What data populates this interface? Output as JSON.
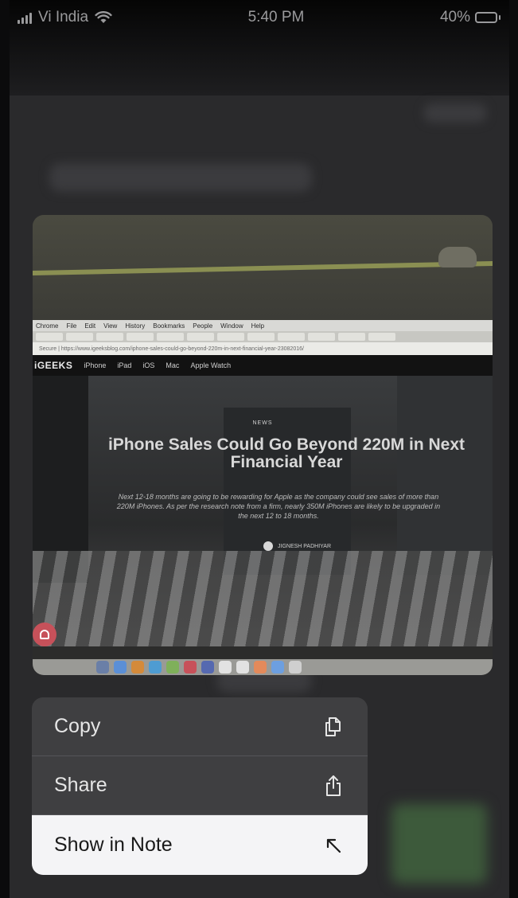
{
  "status_bar": {
    "carrier": "Vi India",
    "time": "5:40 PM",
    "battery_percent": "40%",
    "battery_level": 0.4,
    "icons": [
      "signal-icon",
      "wifi-icon",
      "battery-icon"
    ]
  },
  "preview": {
    "browser_menu": [
      "Chrome",
      "File",
      "Edit",
      "View",
      "History",
      "Bookmarks",
      "People",
      "Window",
      "Help"
    ],
    "url": "Secure | https://www.igeeksblog.com/iphone-sales-could-go-beyond-220m-in-next-financial-year-23082016/",
    "site_logo": "iGEEKS",
    "site_nav": [
      "iPhone",
      "iPad",
      "iOS",
      "Mac",
      "Apple Watch"
    ],
    "article": {
      "tag": "NEWS",
      "headline": "iPhone Sales Could Go Beyond 220M in Next Financial Year",
      "lede": "Next 12-18 months are going to be rewarding for Apple as the company could see sales of more than 220M iPhones. As per the research note from a firm, nearly 350M iPhones are likely to be upgraded in the next 12 to 18 months.",
      "author": "JIGNESH PADHIYAR"
    }
  },
  "context_menu": {
    "items": [
      {
        "label": "Copy",
        "icon": "copy-icon"
      },
      {
        "label": "Share",
        "icon": "share-icon"
      },
      {
        "label": "Show in Note",
        "icon": "arrow-up-left-icon"
      }
    ],
    "highlighted": "Show in Note"
  },
  "colors": {
    "menu_dark": "#3f3f41",
    "menu_highlight": "#f4f4f6",
    "dimmed_background": "#2a2a2c"
  }
}
